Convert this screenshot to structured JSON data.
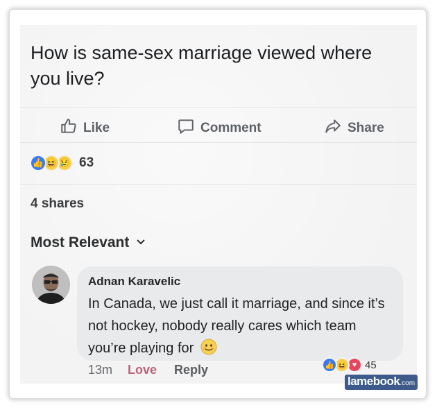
{
  "post": {
    "text": "How is same-sex marriage viewed where you live?"
  },
  "actions": {
    "like_label": "Like",
    "comment_label": "Comment",
    "share_label": "Share"
  },
  "reactions": {
    "count": "63",
    "icons": [
      "like-icon",
      "haha-icon",
      "sad-icon"
    ]
  },
  "shares": {
    "label": "4 shares"
  },
  "filter": {
    "label": "Most Relevant"
  },
  "comment": {
    "author": "Adnan Karavelic",
    "text": "In Canada, we just call it marriage, and since it’s not hockey, nobody really cares which team you’re playing for",
    "time": "13m",
    "love_label": "Love",
    "reply_label": "Reply",
    "reaction_count": "45",
    "reaction_icons": [
      "like-icon",
      "haha-icon",
      "love-icon"
    ]
  },
  "watermark": {
    "main": "lamebook",
    "domain": ".com"
  },
  "colors": {
    "like_blue": "#3b7af2",
    "love_red": "#e8455e",
    "love_text": "#b96378",
    "emoji_yellow": "#f7d154"
  }
}
